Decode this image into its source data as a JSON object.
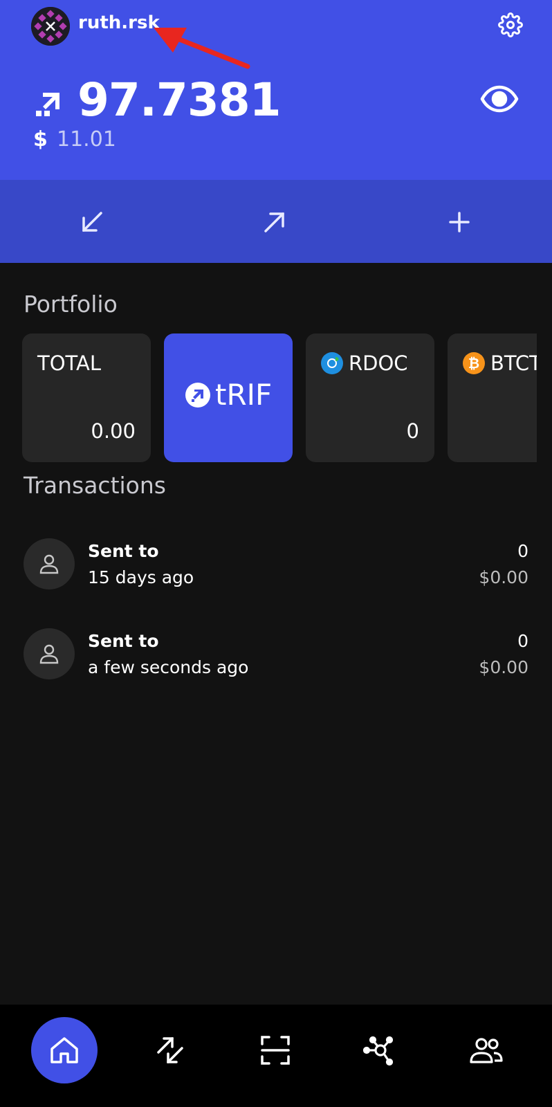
{
  "header": {
    "username": "ruth.rsk",
    "balance": "97.7381",
    "fiat_symbol": "$",
    "fiat_value": "11.01",
    "brand_color": "#4150e6"
  },
  "actions": [
    {
      "name": "receive",
      "icon": "arrow-down-left-icon"
    },
    {
      "name": "send",
      "icon": "arrow-up-right-icon"
    },
    {
      "name": "add",
      "icon": "plus-icon"
    }
  ],
  "portfolio": {
    "title": "Portfolio",
    "cards": [
      {
        "label": "TOTAL",
        "value": "0.00"
      },
      {
        "label": "tRIF",
        "value": ""
      },
      {
        "label": "RDOC",
        "value": "0"
      },
      {
        "label": "BTCT",
        "value": ""
      }
    ]
  },
  "transactions": {
    "title": "Transactions",
    "items": [
      {
        "title": "Sent to",
        "time": "15 days ago",
        "amount": "0",
        "fiat": "$0.00"
      },
      {
        "title": "Sent to",
        "time": "a few seconds ago",
        "amount": "0",
        "fiat": "$0.00"
      }
    ]
  },
  "nav": [
    {
      "name": "home",
      "icon": "home-icon",
      "active": true
    },
    {
      "name": "activity",
      "icon": "transfer-icon"
    },
    {
      "name": "scan",
      "icon": "scan-icon"
    },
    {
      "name": "dapps",
      "icon": "network-icon"
    },
    {
      "name": "contacts",
      "icon": "contacts-icon"
    }
  ]
}
